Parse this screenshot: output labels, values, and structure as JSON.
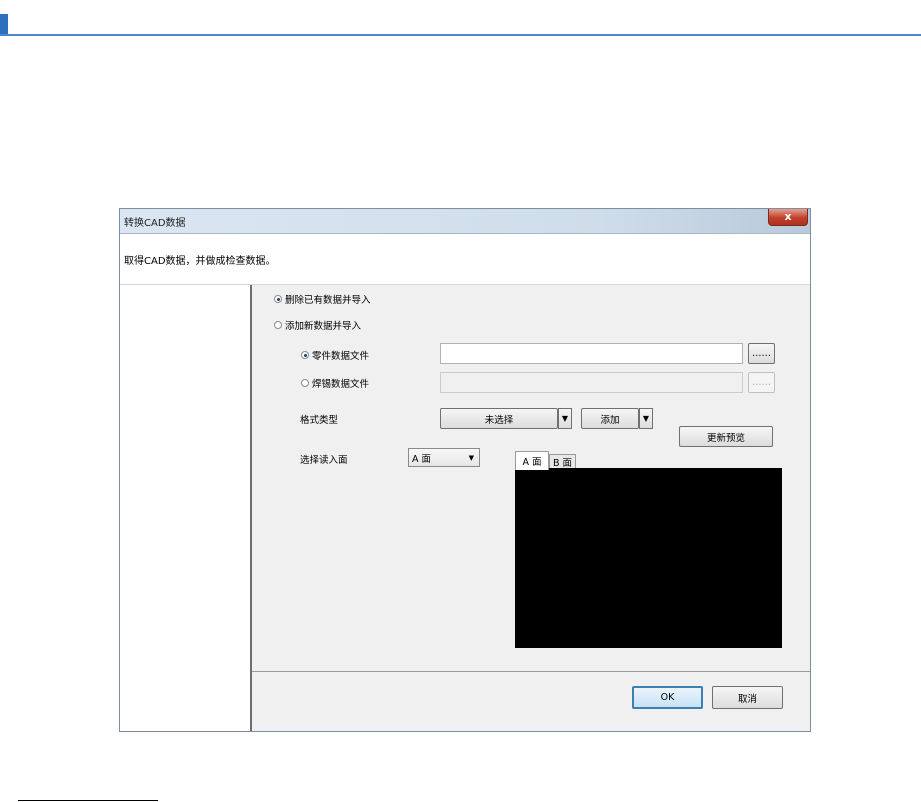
{
  "dialog": {
    "title": "转换CAD数据",
    "close_glyph": "x",
    "description": "取得CAD数据，并做成检查数据。"
  },
  "import_mode": {
    "options": [
      {
        "label": "删除已有数据并导入",
        "selected": true
      },
      {
        "label": "添加新数据并导入",
        "selected": false
      }
    ]
  },
  "file_source": {
    "options": [
      {
        "label": "零件数据文件",
        "selected": true
      },
      {
        "label": "焊锡数据文件",
        "selected": false
      }
    ],
    "browse_label": "……",
    "part_file_value": "",
    "solder_file_value": ""
  },
  "format": {
    "label": "格式类型",
    "selected": "未选择",
    "add_label": "添加",
    "update_preview_label": "更新预览"
  },
  "side": {
    "label": "选择读入面",
    "selected": "A 面",
    "tabs": [
      "A 面",
      "B 面"
    ]
  },
  "buttons": {
    "ok": "OK",
    "cancel": "取消"
  },
  "colors": {
    "accent": "#2f6fbf",
    "preview_bg": "#000000",
    "default_button_border": "#3c7fb1"
  }
}
